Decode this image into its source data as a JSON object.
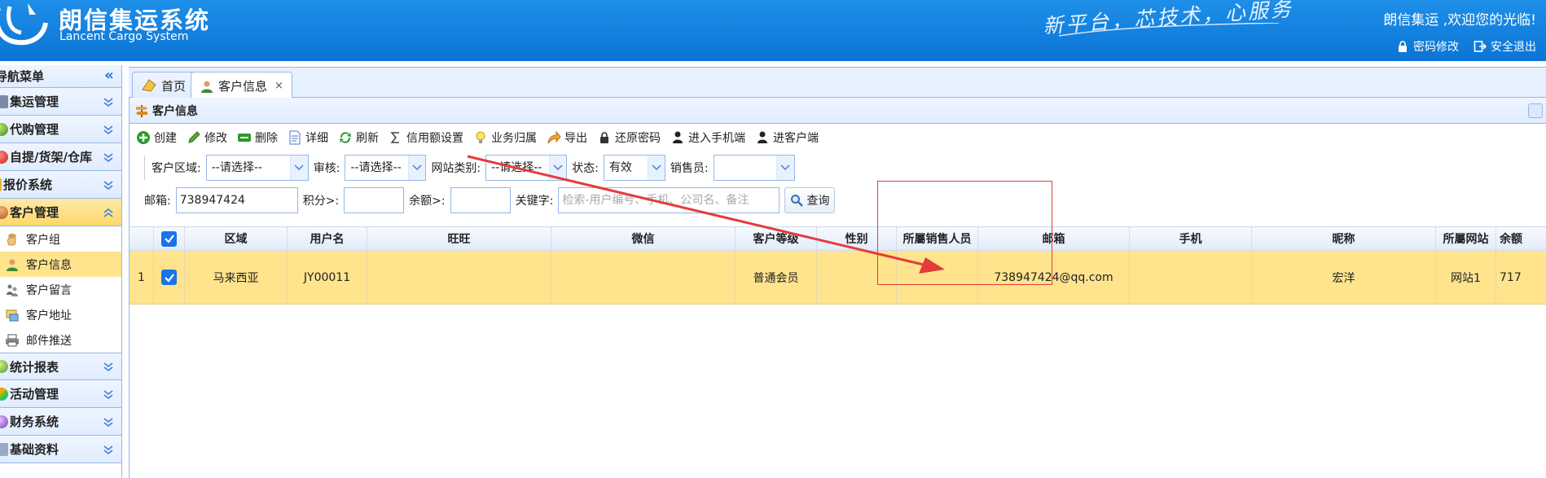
{
  "header": {
    "title": "朗信集运系统",
    "subtitle": "Lancent Cargo System",
    "slogan": "新平台，芯技术，心服务",
    "welcome": "朗信集运 ,欢迎您的光临!",
    "links": [
      {
        "label": "密码修改",
        "icon": "lock-icon"
      },
      {
        "label": "安全退出",
        "icon": "logout-icon"
      }
    ]
  },
  "sidebar": {
    "title": "导航菜单",
    "groups": [
      {
        "label": "集运管理",
        "expanded": false
      },
      {
        "label": "代购管理",
        "expanded": false
      },
      {
        "label": "自提/货架/仓库",
        "expanded": false
      },
      {
        "label": "报价系统",
        "expanded": false
      },
      {
        "label": "客户管理",
        "expanded": true
      },
      {
        "label": "统计报表",
        "expanded": false
      },
      {
        "label": "活动管理",
        "expanded": false
      },
      {
        "label": "财务系统",
        "expanded": false
      },
      {
        "label": "基础资料",
        "expanded": false
      }
    ],
    "customer_items": [
      {
        "label": "客户组",
        "icon": "hand-icon"
      },
      {
        "label": "客户信息",
        "icon": "user-icon",
        "selected": true
      },
      {
        "label": "客户留言",
        "icon": "message-icon"
      },
      {
        "label": "客户地址",
        "icon": "address-icon"
      },
      {
        "label": "邮件推送",
        "icon": "printer-icon"
      }
    ]
  },
  "tabs": [
    {
      "label": "首页",
      "icon": "home-icon"
    },
    {
      "label": "客户信息",
      "icon": "user-icon",
      "closable": true,
      "close": "×"
    }
  ],
  "panel": {
    "title": "客户信息"
  },
  "toolbar": {
    "buttons": [
      {
        "label": "创建",
        "icon": "add-icon"
      },
      {
        "label": "修改",
        "icon": "edit-icon"
      },
      {
        "label": "删除",
        "icon": "delete-icon"
      },
      {
        "label": "详细",
        "icon": "detail-icon"
      },
      {
        "label": "刷新",
        "icon": "refresh-icon"
      },
      {
        "label": "信用额设置",
        "icon": "sigma-icon"
      },
      {
        "label": "业务归属",
        "icon": "bulb-icon"
      },
      {
        "label": "导出",
        "icon": "export-icon"
      },
      {
        "label": "还原密码",
        "icon": "lock-icon"
      },
      {
        "label": "进入手机端",
        "icon": "person-icon"
      },
      {
        "label": "进客户端",
        "icon": "person-icon"
      }
    ]
  },
  "filters": {
    "region_label": "客户区域:",
    "region_value": "--请选择--",
    "audit_label": "审核:",
    "audit_value": "--请选择--",
    "site_type_label": "网站类别:",
    "site_type_value": "--请选择--",
    "status_label": "状态:",
    "status_value": "有效",
    "sales_label": "销售员:",
    "sales_value": "",
    "email_label": "邮箱:",
    "email_value": "738947424",
    "points_label": "积分>:",
    "points_value": "",
    "balance_label": "余额>:",
    "balance_value": "",
    "keyword_label": "关键字:",
    "keyword_placeholder": "检索-用户编号、手机、公司名、备注",
    "search_label": "查询"
  },
  "table": {
    "columns": [
      "区域",
      "用户名",
      "旺旺",
      "微信",
      "客户等级",
      "性别",
      "所屬销售人员",
      "邮箱",
      "手机",
      "昵称",
      "所屬网站",
      "余额"
    ],
    "rows": [
      {
        "index": "1",
        "checked": true,
        "cells": [
          "马来西亚",
          "JY00011",
          "",
          "",
          "普通会员",
          "",
          "",
          "738947424@qq.com",
          "",
          "宏洋",
          "网站1",
          "717"
        ]
      }
    ]
  },
  "colors": {
    "header_blue": "#0b74d6",
    "border_blue": "#95b8e7",
    "selected_row": "#ffe48d",
    "annotation_red": "#e53b3b"
  }
}
